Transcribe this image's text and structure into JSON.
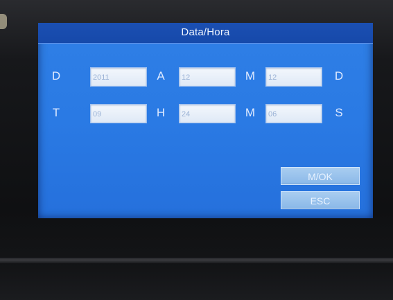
{
  "window": {
    "title": "Data/Hora"
  },
  "date_row": {
    "labels": [
      "D",
      "A",
      "M",
      "D"
    ],
    "fields": [
      "2011",
      "12",
      "12"
    ]
  },
  "time_row": {
    "labels": [
      "T",
      "H",
      "M",
      "S"
    ],
    "fields": [
      "09",
      "24",
      "06"
    ]
  },
  "buttons": {
    "ok_label": "M/OK",
    "esc_label": "ESC"
  },
  "colors": {
    "screen_blue": "#2a7ae4",
    "title_bar_blue": "#1649aa",
    "field_bg": "#e8eff9",
    "button_bg": "#9ac3ec"
  }
}
